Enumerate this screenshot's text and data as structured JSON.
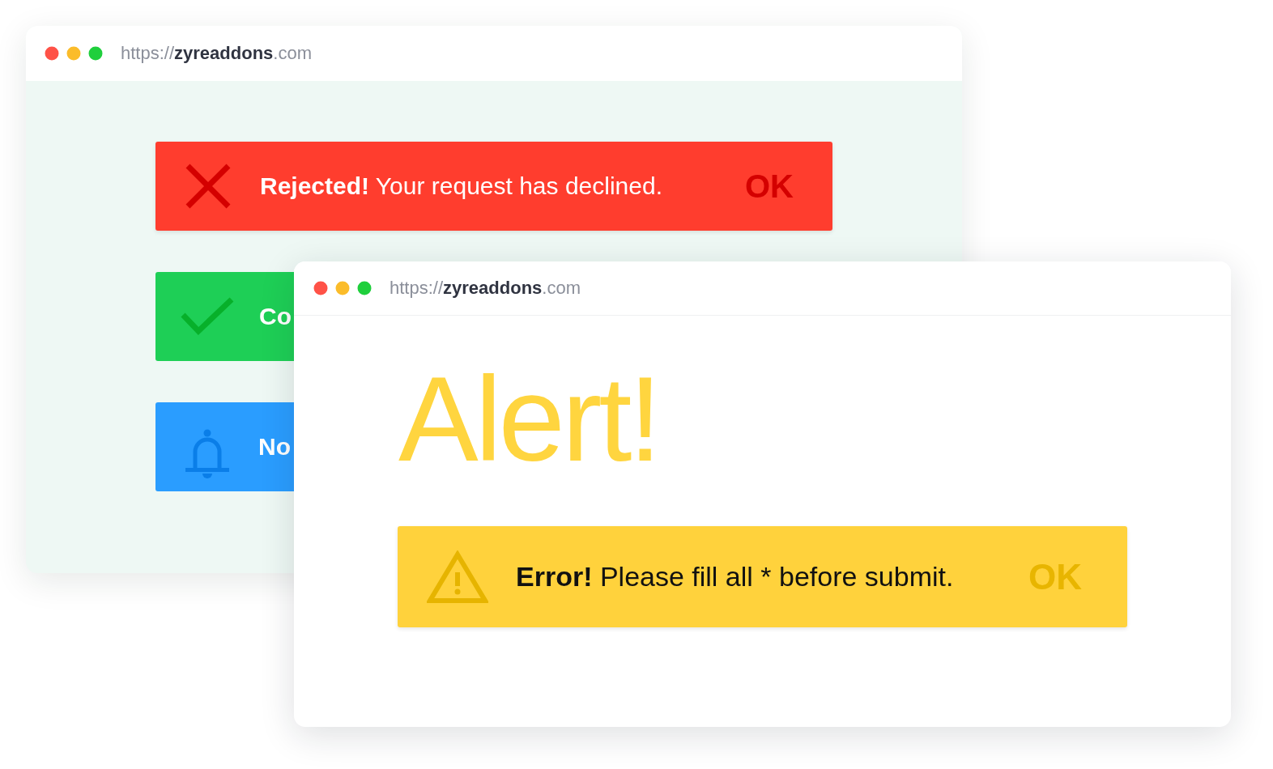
{
  "windows": [
    {
      "url": "https://**zyreaddons**.com",
      "alerts": [
        {
          "kind": "error",
          "title": "Rejected!",
          "text": "Your request has declined.",
          "button": "OK"
        },
        {
          "kind": "success",
          "title": "Co"
        },
        {
          "kind": "info",
          "title": "No"
        }
      ]
    },
    {
      "url": "https://**zyreaddons**.com",
      "heading": "Alert!",
      "alerts": [
        {
          "kind": "warning",
          "title": "Error!",
          "text": "Please fill all * before submit.",
          "button": "OK"
        }
      ]
    }
  ]
}
